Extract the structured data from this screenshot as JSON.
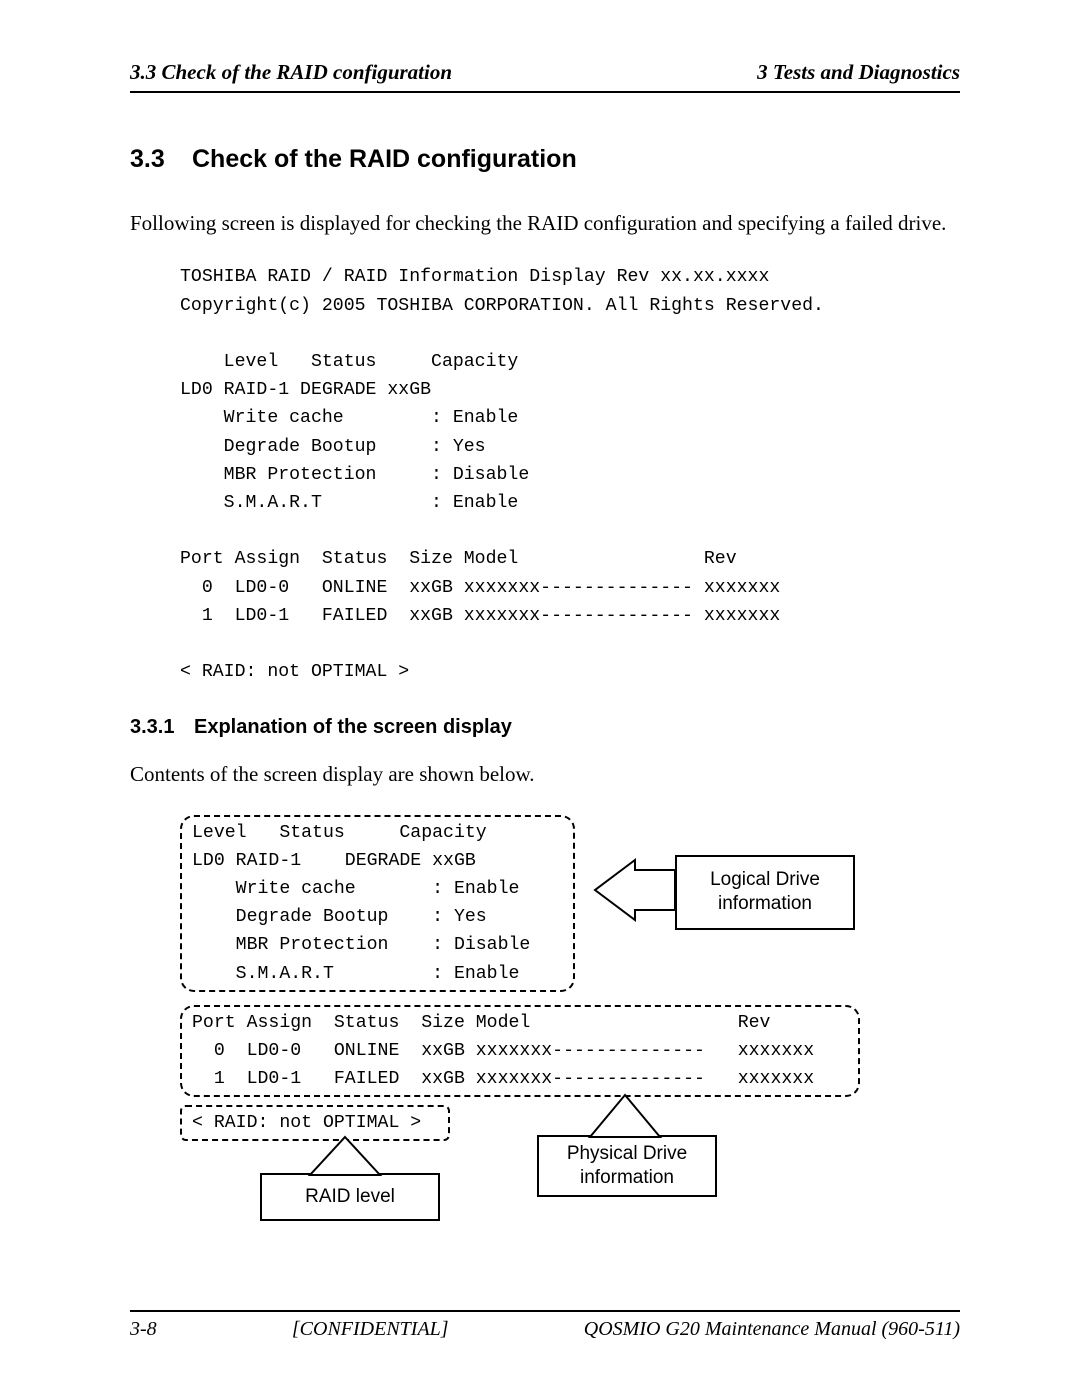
{
  "header": {
    "left": "3.3 Check of the RAID configuration",
    "right": "3 Tests and Diagnostics"
  },
  "section": {
    "number": "3.3",
    "title": "Check of the RAID configuration"
  },
  "intro": "Following screen is displayed for checking the RAID configuration and specifying a failed drive.",
  "terminal": "TOSHIBA RAID / RAID Information Display Rev xx.xx.xxxx\nCopyright(c) 2005 TOSHIBA CORPORATION. All Rights Reserved.\n\n    Level   Status     Capacity\nLD0 RAID-1 DEGRADE xxGB\n    Write cache        : Enable\n    Degrade Bootup     : Yes\n    MBR Protection     : Disable\n    S.M.A.R.T          : Enable\n\nPort Assign  Status  Size Model                 Rev\n  0  LD0-0   ONLINE  xxGB xxxxxxx-------------- xxxxxxx\n  1  LD0-1   FAILED  xxGB xxxxxxx-------------- xxxxxxx\n\n< RAID: not OPTIMAL >",
  "subsection": {
    "number": "3.3.1",
    "title": "Explanation of the screen display"
  },
  "subintro": "Contents of the screen display are shown below.",
  "diagram": {
    "logical_box": "Level   Status     Capacity\nLD0 RAID-1    DEGRADE xxGB\n    Write cache       : Enable\n    Degrade Bootup    : Yes\n    MBR Protection    : Disable\n    S.M.A.R.T         : Enable",
    "physical_box": "Port Assign  Status  Size Model                   Rev\n  0  LD0-0   ONLINE  xxGB xxxxxxx--------------   xxxxxxx\n  1  LD0-1   FAILED  xxGB xxxxxxx--------------   xxxxxxx",
    "raid_box": "< RAID: not OPTIMAL >",
    "callouts": {
      "logical": "Logical Drive information",
      "physical": "Physical Drive information",
      "raid_level": "RAID level"
    }
  },
  "footer": {
    "page": "3-8",
    "confidential": "[CONFIDENTIAL]",
    "manual": "QOSMIO G20 Maintenance Manual (960-511)"
  }
}
